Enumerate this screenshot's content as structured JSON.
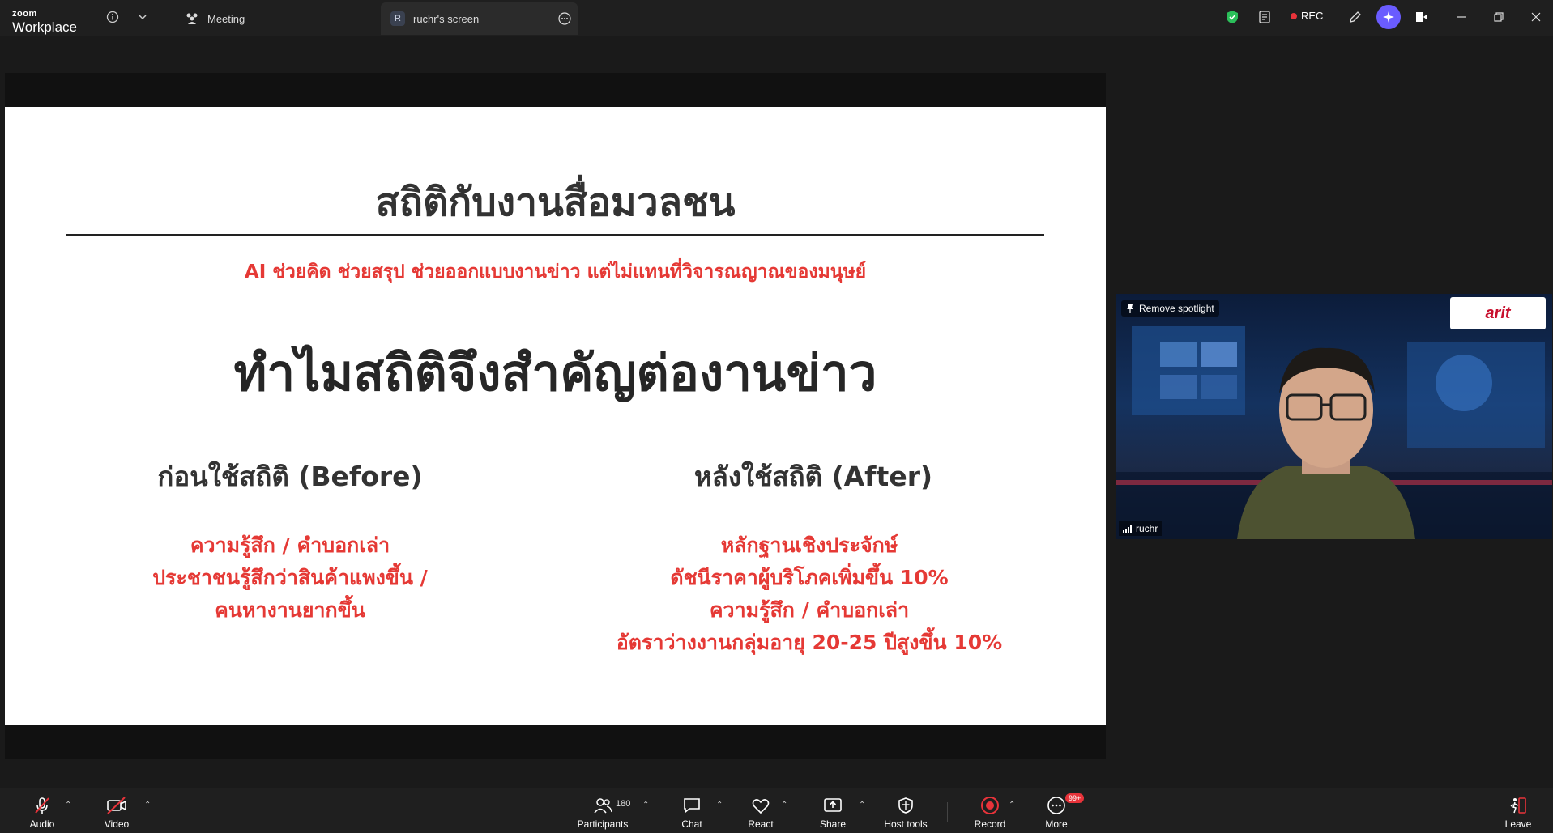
{
  "titlebar": {
    "brand_small": "zoom",
    "brand_large": "Workplace",
    "meeting_tab": "Meeting",
    "screen_tab_badge": "R",
    "screen_tab": "ruchr's screen",
    "rec_label": "REC",
    "icons": [
      "info-icon",
      "chevron-down-icon",
      "meeting-icon",
      "more-icon",
      "shield-icon",
      "notes-icon",
      "edit-icon",
      "ai-companion-icon",
      "apps-icon",
      "minimize-icon",
      "restore-icon",
      "close-icon"
    ]
  },
  "slide": {
    "title": "สถิติกับงานสื่อมวลชน",
    "subtitle": "AI ช่วยคิด ช่วยสรุป ช่วยออกแบบงานข่าว แต่ไม่แทนที่วิจารณญาณของมนุษย์",
    "heading": "ทำไมสถิติจึงสำคัญต่องานข่าว",
    "before": {
      "header": "ก่อนใช้สถิติ (Before)",
      "lines": [
        "ความรู้สึก / คำบอกเล่า",
        "ประชาชนรู้สึกว่าสินค้าแพงขึ้น /",
        "คนหางานยากขึ้น"
      ]
    },
    "after": {
      "header": "หลังใช้สถิติ (After)",
      "lines": [
        "หลักฐานเชิงประจักษ์",
        "ดัชนีราคาผู้บริโภคเพิ่มขึ้น 10%",
        "ความรู้สึก / คำบอกเล่า",
        "อัตราว่างงานกลุ่มอายุ 20-25 ปีสูงขึ้น 10%"
      ]
    }
  },
  "video_tile": {
    "remove_spotlight": "Remove spotlight",
    "participant_name": "ruchr",
    "logo_text": "arit"
  },
  "toolbar": {
    "audio": "Audio",
    "video": "Video",
    "participants": "Participants",
    "participants_count": "180",
    "chat": "Chat",
    "react": "React",
    "share": "Share",
    "host_tools": "Host tools",
    "record": "Record",
    "more": "More",
    "more_badge": "99+",
    "leave": "Leave"
  },
  "colors": {
    "accent_red": "#e53935",
    "shield_green": "#2bbf5a",
    "ai_purple": "#6a5cff"
  }
}
